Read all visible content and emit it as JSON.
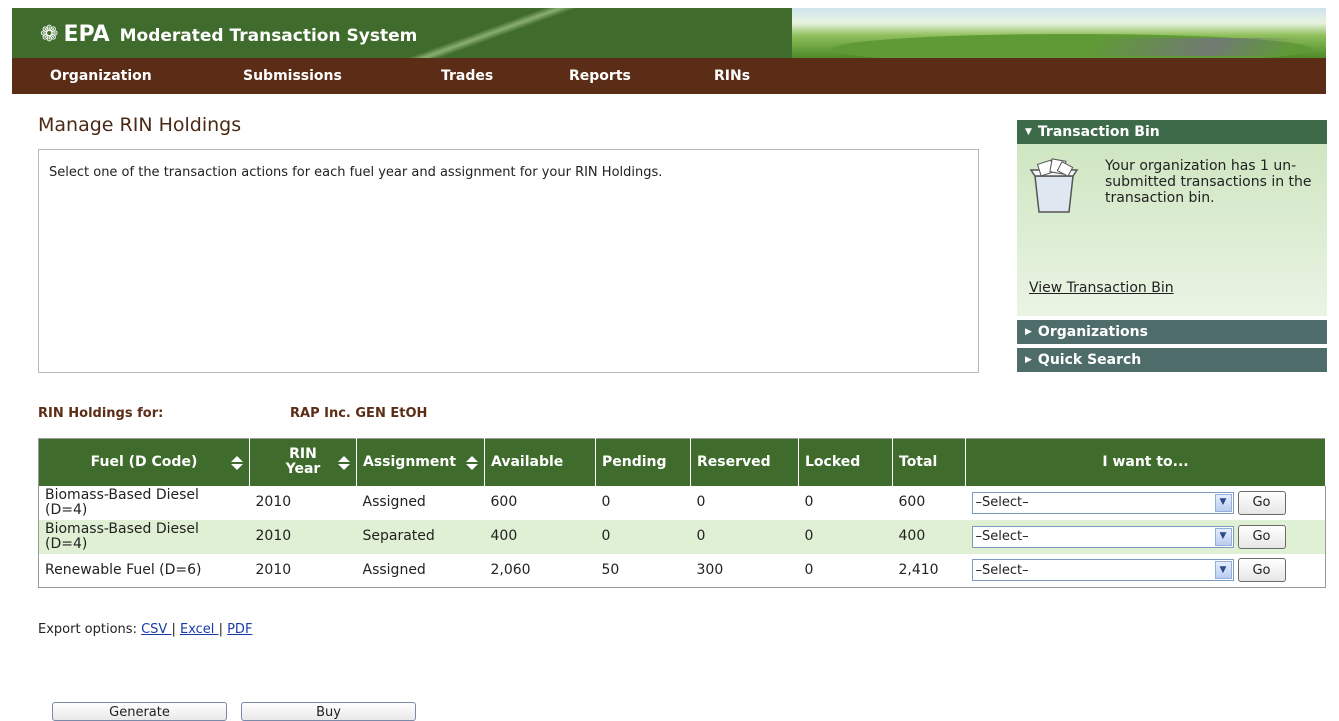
{
  "header": {
    "logo_mark": "❁",
    "logo_text": "EPA",
    "app_title": "Moderated Transaction System"
  },
  "nav": [
    {
      "label": "Organization"
    },
    {
      "label": "Submissions"
    },
    {
      "label": "Trades"
    },
    {
      "label": "Reports"
    },
    {
      "label": "RINs"
    }
  ],
  "main": {
    "page_title": "Manage RIN Holdings",
    "instructions": "Select one of the transaction actions for each fuel year and assignment for your RIN Holdings."
  },
  "sidebar": {
    "transaction_bin": {
      "title": "Transaction Bin",
      "message": "Your organization has 1 un-submitted transactions in the transaction bin.",
      "link": "View Transaction Bin"
    },
    "organizations": {
      "title": "Organizations"
    },
    "quick_search": {
      "title": "Quick Search"
    }
  },
  "holdings": {
    "label": "RIN Holdings for:",
    "organization": "RAP Inc. GEN EtOH",
    "columns": [
      "Fuel (D Code)",
      "RIN Year",
      "Assignment",
      "Available",
      "Pending",
      "Reserved",
      "Locked",
      "Total",
      "I want to..."
    ],
    "rows": [
      {
        "fuel": "Biomass-Based Diesel (D=4)",
        "year": "2010",
        "assignment": "Assigned",
        "available": "600",
        "pending": "0",
        "reserved": "0",
        "locked": "0",
        "total": "600",
        "action": "–Select–",
        "go": "Go"
      },
      {
        "fuel": "Biomass-Based Diesel (D=4)",
        "year": "2010",
        "assignment": "Separated",
        "available": "400",
        "pending": "0",
        "reserved": "0",
        "locked": "0",
        "total": "400",
        "action": "–Select–",
        "go": "Go"
      },
      {
        "fuel": "Renewable Fuel (D=6)",
        "year": "2010",
        "assignment": "Assigned",
        "available": "2,060",
        "pending": "50",
        "reserved": "300",
        "locked": "0",
        "total": "2,410",
        "action": "–Select–",
        "go": "Go"
      }
    ]
  },
  "export": {
    "label": "Export options:",
    "csv": "CSV ",
    "sep1": "|",
    "excel": "Excel ",
    "sep2": "|",
    "pdf": "PDF"
  },
  "buttons": {
    "generate": "Generate",
    "buy": "Buy"
  },
  "colors": {
    "header_green": "#3f6b2c",
    "nav_brown": "#5b2d16",
    "sidebar_head": "#3d6a48",
    "row_alt": "#dff0d4"
  }
}
